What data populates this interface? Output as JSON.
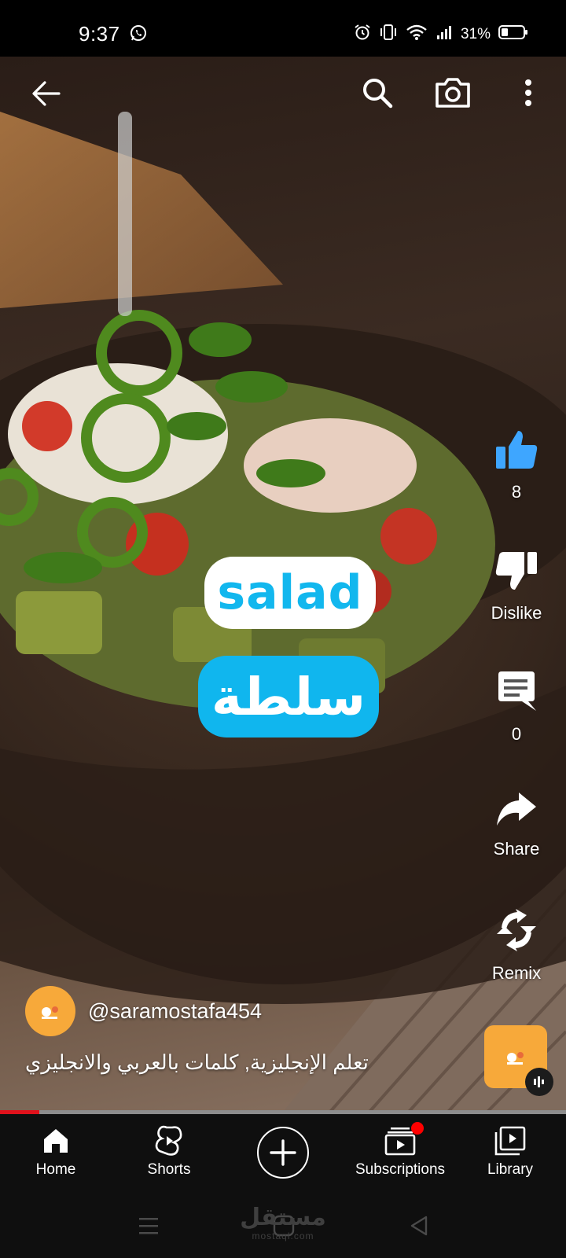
{
  "status_bar": {
    "time": "9:37",
    "battery_percent": "31%",
    "battery_level": 0.31,
    "icons": [
      "whatsapp-icon",
      "alarm-icon",
      "vibrate-icon",
      "wifi-icon",
      "signal-icon",
      "battery-icon"
    ]
  },
  "top_bar": {
    "icons": [
      "back-arrow-icon",
      "search-icon",
      "camera-icon",
      "more-vert-icon"
    ]
  },
  "video": {
    "word_english": "salad",
    "word_arabic": "سلطة"
  },
  "actions": {
    "like_count": "8",
    "dislike_label": "Dislike",
    "comment_count": "0",
    "share_label": "Share",
    "remix_label": "Remix"
  },
  "channel": {
    "handle": "@saramostafa454"
  },
  "caption": "تعلم الإنجليزية, كلمات بالعربي والانجليزي",
  "progress": 0.07,
  "bottom_nav": {
    "home": "Home",
    "shorts": "Shorts",
    "subscriptions": "Subscriptions",
    "library": "Library"
  },
  "watermark": {
    "main": "مستقل",
    "sub": "mostaql.com"
  },
  "colors": {
    "accent_blue": "#10b6ee",
    "like_blue": "#3ea6ff",
    "progress_red": "#e0111b",
    "avatar_orange": "#f7a93a",
    "nav_bg": "#0f0f0f"
  }
}
